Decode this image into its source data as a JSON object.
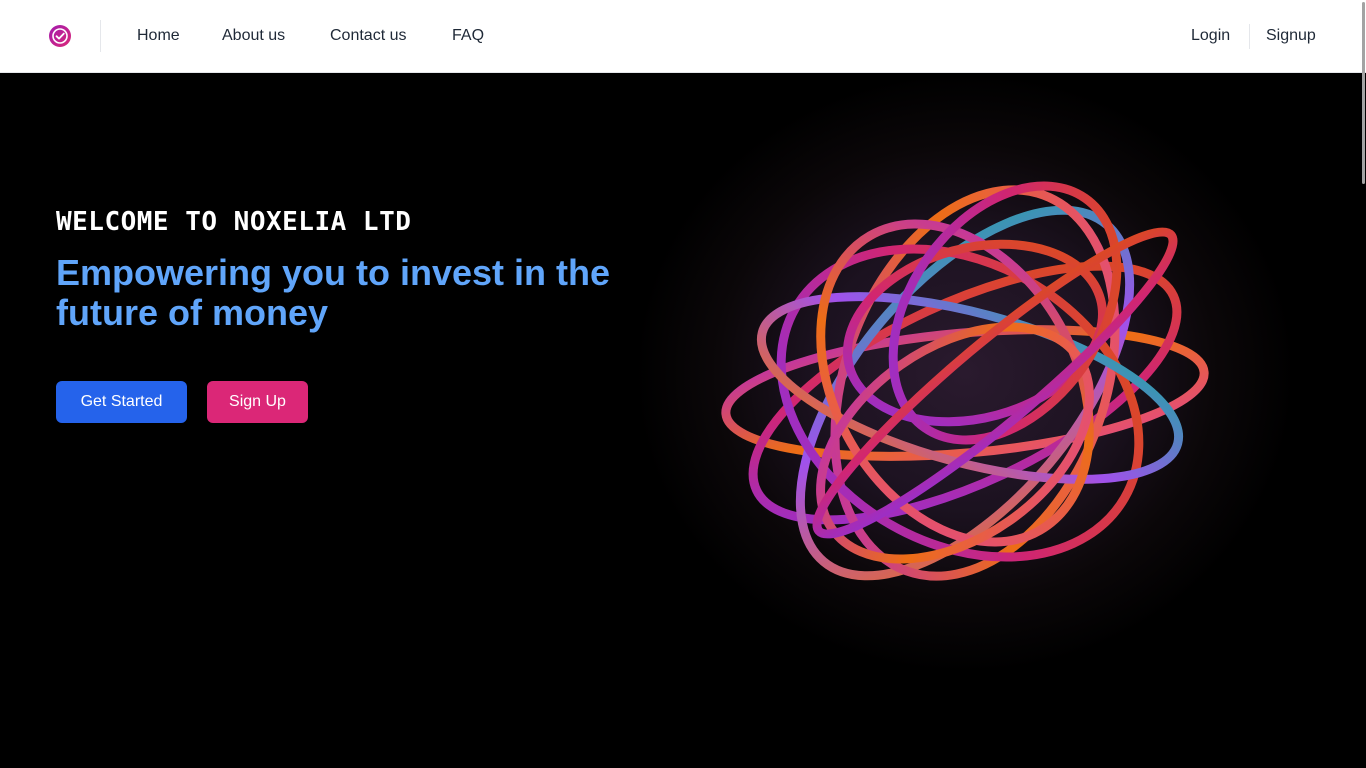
{
  "nav": {
    "links": [
      "Home",
      "About us",
      "Contact us",
      "FAQ"
    ],
    "login": "Login",
    "signup": "Signup",
    "logo_icon": "shield-check-icon"
  },
  "hero": {
    "welcome": "WELCOME TO NOXELIA LTD",
    "headline": "Empowering you to invest in the future of money",
    "get_started": "Get Started",
    "sign_up": "Sign Up"
  },
  "colors": {
    "primary_button": "#2563eb",
    "secondary_button": "#db2777",
    "headline": "#60a5fa",
    "logo": "#c026d3"
  }
}
